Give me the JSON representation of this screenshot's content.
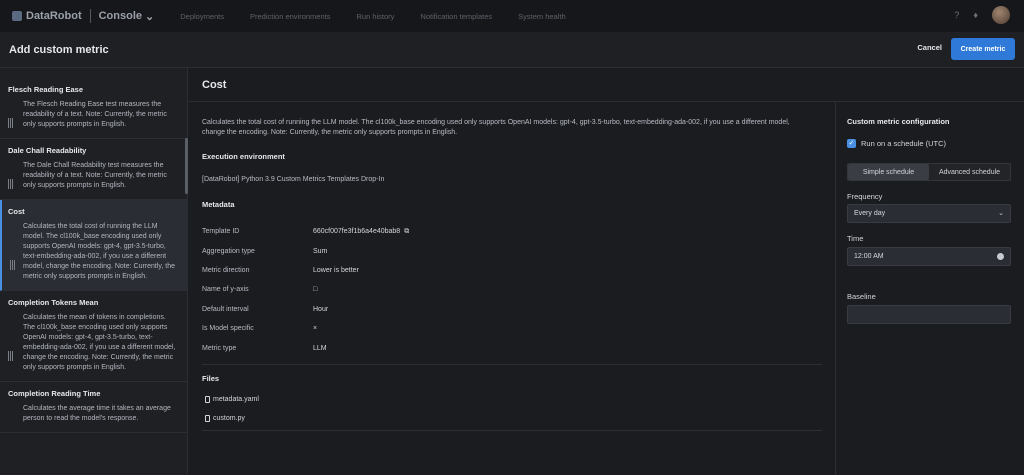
{
  "nav": {
    "brand": "DataRobot",
    "section": "Console",
    "links": [
      "Deployments",
      "Prediction environments",
      "Run history",
      "Notification templates",
      "System health"
    ],
    "help_icon": "question-icon",
    "notif_icon": "bell-icon"
  },
  "modal": {
    "title": "Add custom metric",
    "cancel_label": "Cancel",
    "create_label": "Create metric"
  },
  "templates": [
    {
      "title": "Flesch Reading Ease",
      "desc": "The Flesch Reading Ease test measures the readability of a text. Note: Currently, the metric only supports prompts in English."
    },
    {
      "title": "Dale Chall Readability",
      "desc": "The Dale Chall Readability test measures the readability of a text. Note: Currently, the metric only supports prompts in English."
    },
    {
      "title": "Cost",
      "desc": "Calculates the total cost of running the LLM model. The cl100k_base encoding used only supports OpenAI models: gpt-4, gpt-3.5-turbo, text-embedding-ada-002, if you use a different model, change the encoding. Note: Currently, the metric only supports prompts in English."
    },
    {
      "title": "Completion Tokens Mean",
      "desc": "Calculates the mean of tokens in completions. The cl100k_base encoding used only supports OpenAI models: gpt-4, gpt-3.5-turbo, text-embedding-ada-002, if you use a different model, change the encoding. Note: Currently, the metric only supports prompts in English."
    },
    {
      "title": "Completion Reading Time",
      "desc": "Calculates the average time it takes an average person to read the model's response."
    }
  ],
  "detail": {
    "title": "Cost",
    "description": "Calculates the total cost of running the LLM model. The cl100k_base encoding used only supports OpenAI models: gpt-4, gpt-3.5-turbo, text-embedding-ada-002, if you use a different model, change the encoding. Note: Currently, the metric only supports prompts in English.",
    "env_label": "Execution environment",
    "env_value": "[DataRobot] Python 3.9 Custom Metrics Templates Drop-In",
    "metadata_label": "Metadata",
    "metadata": [
      {
        "key": "Template ID",
        "value": "660cf007fe3f1b6a4e40bab8"
      },
      {
        "key": "Aggregation type",
        "value": "Sum"
      },
      {
        "key": "Metric direction",
        "value": "Lower is better"
      },
      {
        "key": "Name of y-axis",
        "value": "□"
      },
      {
        "key": "Default interval",
        "value": "Hour"
      },
      {
        "key": "Is Model specific",
        "value": "×"
      },
      {
        "key": "Metric type",
        "value": "LLM"
      }
    ],
    "files_label": "Files",
    "files": [
      "metadata.yaml",
      "custom.py"
    ]
  },
  "config": {
    "title": "Custom metric configuration",
    "schedule_checkbox": "Run on a schedule (UTC)",
    "schedule_checked": true,
    "tab_simple": "Simple schedule",
    "tab_advanced": "Advanced schedule",
    "frequency_label": "Frequency",
    "frequency_value": "Every day",
    "time_label": "Time",
    "time_value": "12:00 AM",
    "baseline_label": "Baseline",
    "baseline_value": ""
  },
  "colors": {
    "accent": "#2f7ad8",
    "selected_border": "#4a90e2"
  }
}
